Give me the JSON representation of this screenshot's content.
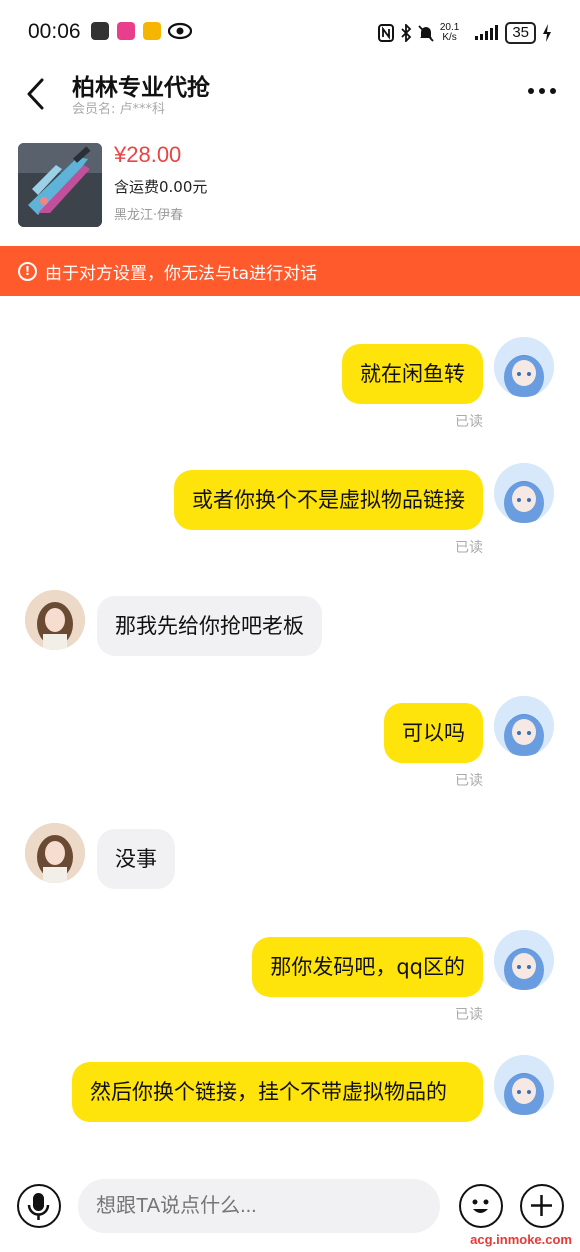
{
  "status_bar": {
    "time": "00:06",
    "net_speed_value": "20.1",
    "net_speed_unit": "K/s",
    "battery": "35"
  },
  "header": {
    "title": "柏林专业代抢",
    "member_label": "会员名: 卢***科"
  },
  "product": {
    "price": "¥28.00",
    "shipping": "含运费0.00元",
    "location": "黑龙江·伊春"
  },
  "notice": {
    "text": "由于对方设置，你无法与ta进行对话",
    "icon": "alert-circle-icon"
  },
  "messages": [
    {
      "from": "me",
      "text": "就在闲鱼转",
      "status": "已读"
    },
    {
      "from": "me",
      "text": "或者你换个不是虚拟物品链接",
      "status": "已读"
    },
    {
      "from": "other",
      "text": "那我先给你抢吧老板"
    },
    {
      "from": "me",
      "text": "可以吗",
      "status": "已读"
    },
    {
      "from": "other",
      "text": "没事"
    },
    {
      "from": "me",
      "text": "那你发码吧，qq区的",
      "status": "已读"
    },
    {
      "from": "me",
      "text": "然后你换个链接，挂个不带虚拟物品的"
    }
  ],
  "input": {
    "placeholder": "想跟TA说点什么..."
  },
  "watermark": "acg.inmoke.com",
  "colors": {
    "my_bubble": "#ffe40b",
    "other_bubble": "#f1f1f3",
    "notice": "#ff5a2c",
    "price": "#e84545"
  }
}
